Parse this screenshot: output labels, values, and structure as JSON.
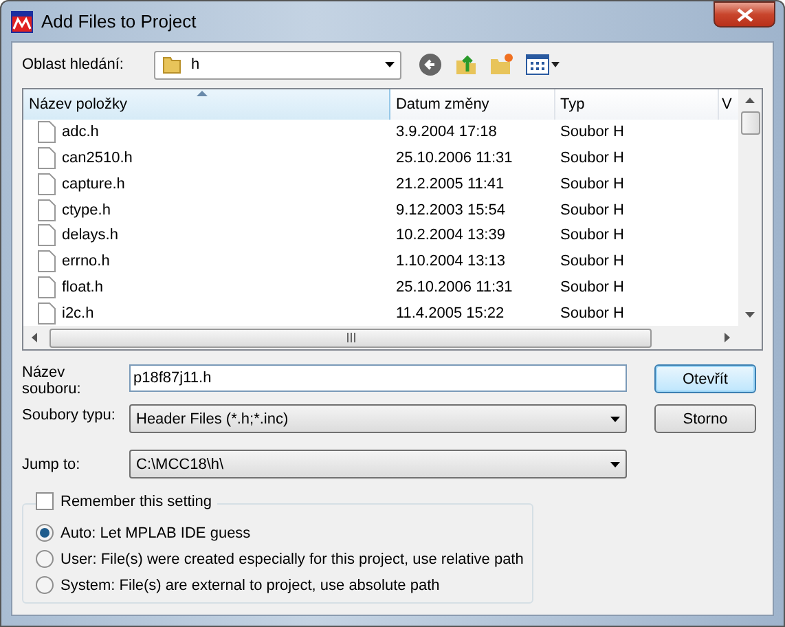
{
  "window": {
    "title": "Add Files to Project"
  },
  "look_in": {
    "label": "Oblast hledání:",
    "value": "h"
  },
  "table": {
    "columns": [
      {
        "label": "Název položky",
        "sorted": true
      },
      {
        "label": "Datum změny",
        "sorted": false
      },
      {
        "label": "Typ",
        "sorted": false
      },
      {
        "label": "V",
        "sorted": false
      }
    ],
    "rows": [
      {
        "name": "adc.h",
        "date": "3.9.2004 17:18",
        "type": "Soubor H"
      },
      {
        "name": "can2510.h",
        "date": "25.10.2006 11:31",
        "type": "Soubor H"
      },
      {
        "name": "capture.h",
        "date": "21.2.2005 11:41",
        "type": "Soubor H"
      },
      {
        "name": "ctype.h",
        "date": "9.12.2003 15:54",
        "type": "Soubor H"
      },
      {
        "name": "delays.h",
        "date": "10.2.2004 13:39",
        "type": "Soubor H"
      },
      {
        "name": "errno.h",
        "date": "1.10.2004 13:13",
        "type": "Soubor H"
      },
      {
        "name": "float.h",
        "date": "25.10.2006 11:31",
        "type": "Soubor H"
      },
      {
        "name": "i2c.h",
        "date": "11.4.2005 15:22",
        "type": "Soubor H"
      }
    ]
  },
  "file_name": {
    "label": "Název souboru:",
    "value": "p18f87j11.h"
  },
  "file_type": {
    "label": "Soubory typu:",
    "value": "Header Files (*.h;*.inc)"
  },
  "jump_to": {
    "label": "Jump to:",
    "value": "C:\\MCC18\\h\\"
  },
  "buttons": [
    {
      "label": "Otevřít",
      "default": true
    },
    {
      "label": "Storno",
      "default": false
    }
  ],
  "remember": {
    "label": "Remember this setting",
    "checked": false
  },
  "options": [
    {
      "label": "Auto: Let MPLAB IDE guess",
      "selected": true
    },
    {
      "label": "User: File(s) were created especially for this project, use relative path",
      "selected": false
    },
    {
      "label": "System: File(s) are external to project, use absolute path",
      "selected": false
    }
  ]
}
